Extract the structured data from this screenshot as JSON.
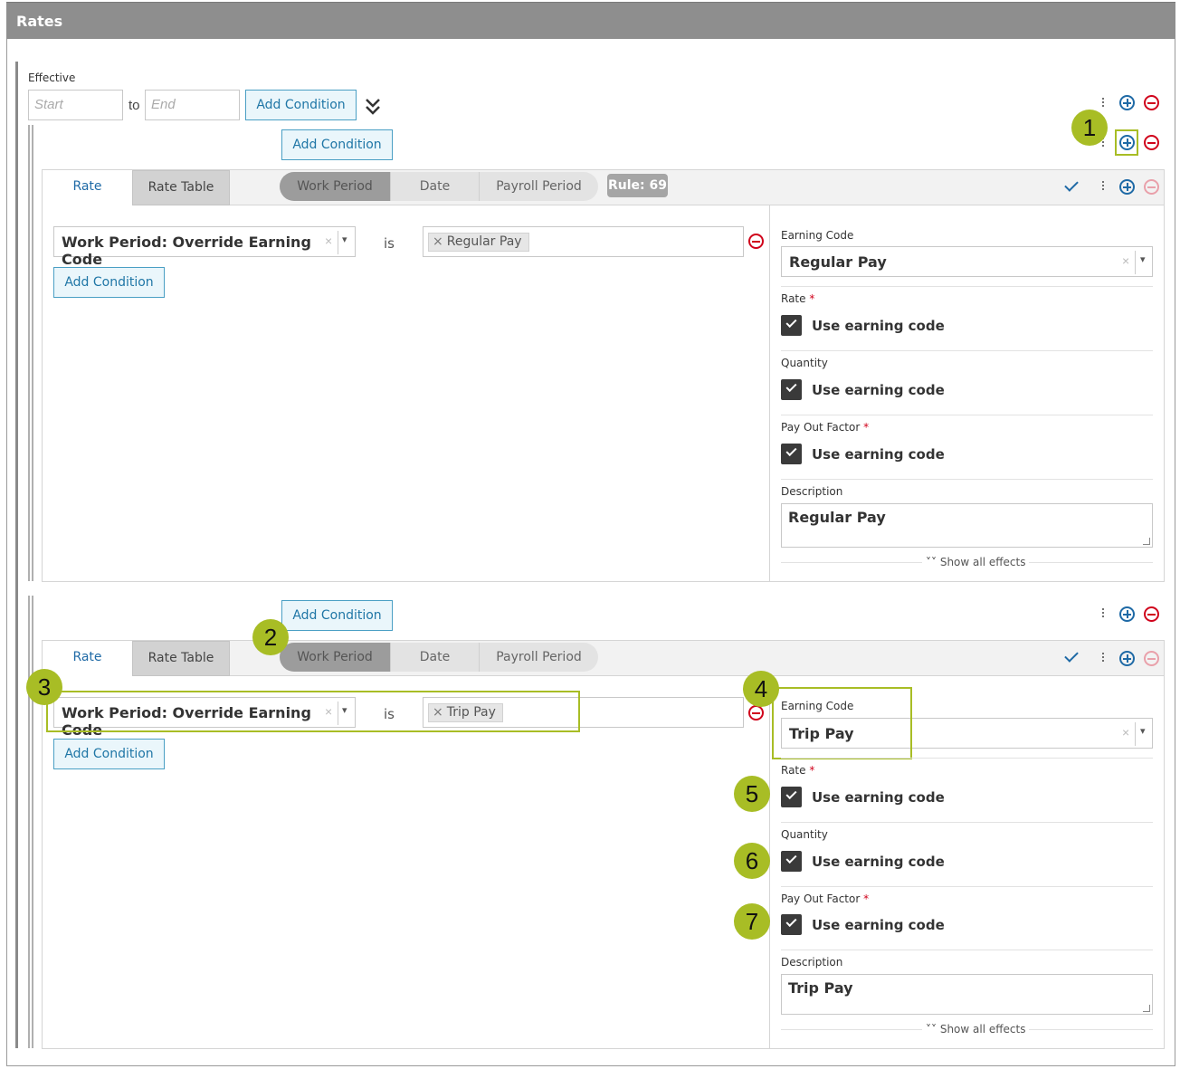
{
  "header": {
    "title": "Rates"
  },
  "effective": {
    "label": "Effective",
    "start_placeholder": "Start",
    "to_label": "to",
    "end_placeholder": "End",
    "add_condition": "Add Condition"
  },
  "common": {
    "add_condition": "Add Condition",
    "is": "is",
    "show_all_effects": "Show all effects",
    "remove_x": "×",
    "caret": "▾"
  },
  "tabs": {
    "rate": "Rate",
    "rate_table": "Rate Table"
  },
  "period_pills": [
    "Work Period",
    "Date",
    "Payroll Period"
  ],
  "rules": [
    {
      "rule_badge": "Rule: 69",
      "condition_field": "Work Period: Override Earning Code",
      "condition_value": "Regular Pay",
      "effects": {
        "earning_code_label": "Earning Code",
        "earning_code_value": "Regular Pay",
        "rate_label": "Rate",
        "rate_checkbox": "Use earning code",
        "quantity_label": "Quantity",
        "quantity_checkbox": "Use earning code",
        "payout_label": "Pay Out Factor",
        "payout_checkbox": "Use earning code",
        "description_label": "Description",
        "description_value": "Regular Pay"
      }
    },
    {
      "rule_badge": "",
      "condition_field": "Work Period: Override Earning Code",
      "condition_value": "Trip Pay",
      "effects": {
        "earning_code_label": "Earning Code",
        "earning_code_value": "Trip Pay",
        "rate_label": "Rate",
        "rate_checkbox": "Use earning code",
        "quantity_label": "Quantity",
        "quantity_checkbox": "Use earning code",
        "payout_label": "Pay Out Factor",
        "payout_checkbox": "Use earning code",
        "description_label": "Description",
        "description_value": "Trip Pay"
      }
    }
  ],
  "required_mark": "*",
  "callouts": [
    "1",
    "2",
    "3",
    "4",
    "5",
    "6",
    "7"
  ],
  "colors": {
    "accent_blue": "#1f6aa6",
    "remove_red": "#d0021b",
    "callout_green": "#a8bd25",
    "header_gray": "#8e8e8e"
  },
  "icons": [
    "add-circle-icon",
    "remove-circle-icon",
    "more-vertical-icon",
    "checkmark-icon",
    "double-chevron-down-icon"
  ]
}
